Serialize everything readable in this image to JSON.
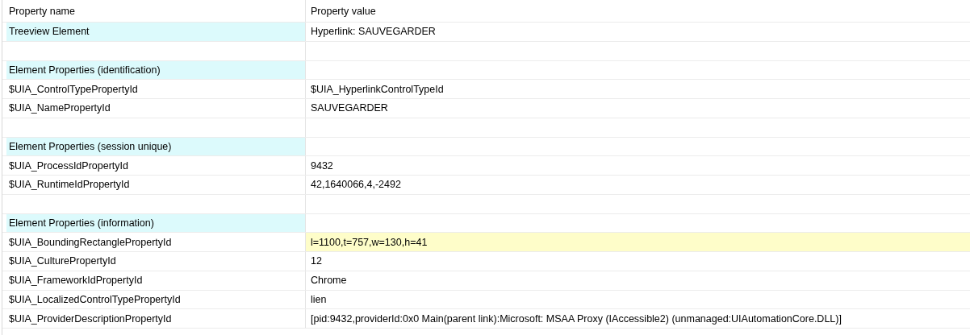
{
  "table": {
    "columns": [
      "Property name",
      "Property value"
    ],
    "rows": [
      {
        "kind": "group",
        "name": "Treeview Element",
        "value": "Hyperlink: SAUVEGARDER",
        "highlighted": false
      },
      {
        "kind": "blank"
      },
      {
        "kind": "group",
        "name": "Element Properties (identification)"
      },
      {
        "kind": "property",
        "name": "$UIA_ControlTypePropertyId",
        "value": "$UIA_HyperlinkControlTypeId",
        "highlighted": false
      },
      {
        "kind": "property",
        "name": "$UIA_NamePropertyId",
        "value": "SAUVEGARDER",
        "highlighted": false
      },
      {
        "kind": "blank"
      },
      {
        "kind": "group",
        "name": "Element Properties (session unique)"
      },
      {
        "kind": "property",
        "name": "$UIA_ProcessIdPropertyId",
        "value": "9432",
        "highlighted": false
      },
      {
        "kind": "property",
        "name": "$UIA_RuntimeIdPropertyId",
        "value": "42,1640066,4,-2492",
        "highlighted": false
      },
      {
        "kind": "blank"
      },
      {
        "kind": "group",
        "name": "Element Properties (information)"
      },
      {
        "kind": "property",
        "name": "$UIA_BoundingRectanglePropertyId",
        "value": "l=1100,t=757,w=130,h=41",
        "highlighted": true
      },
      {
        "kind": "property",
        "name": "$UIA_CulturePropertyId",
        "value": "12",
        "highlighted": false
      },
      {
        "kind": "property",
        "name": "$UIA_FrameworkIdPropertyId",
        "value": "Chrome",
        "highlighted": false
      },
      {
        "kind": "property",
        "name": "$UIA_LocalizedControlTypePropertyId",
        "value": "lien",
        "highlighted": false
      },
      {
        "kind": "property",
        "name": "$UIA_ProviderDescriptionPropertyId",
        "value": "[pid:9432,providerId:0x0 Main(parent link):Microsoft: MSAA Proxy (IAccessible2) (unmanaged:UIAutomationCore.DLL)]",
        "highlighted": false
      }
    ]
  }
}
